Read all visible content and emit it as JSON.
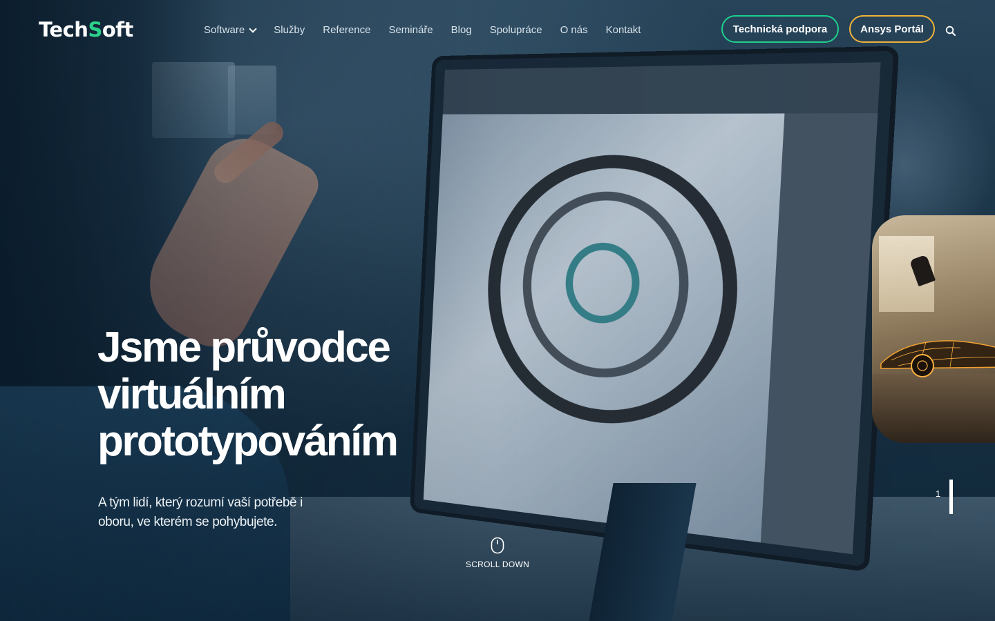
{
  "brand": {
    "logo_text_1": "Tech",
    "logo_text_s": "S",
    "logo_text_2": "oft",
    "accent_green": "#1ed08c",
    "accent_orange": "#f0b23a"
  },
  "nav": {
    "items": [
      {
        "label": "Software",
        "has_dropdown": true
      },
      {
        "label": "Služby"
      },
      {
        "label": "Reference"
      },
      {
        "label": "Semináře"
      },
      {
        "label": "Blog"
      },
      {
        "label": "Spolupráce"
      },
      {
        "label": "O nás"
      },
      {
        "label": "Kontakt"
      }
    ],
    "dropdown_icon": "chevron-down-icon"
  },
  "actions": {
    "support_label": "Technická podpora",
    "portal_label": "Ansys Portál",
    "search_icon": "search-icon"
  },
  "hero": {
    "headline": "Jsme průvodce virtuálním prototypováním",
    "subline": "A tým lidí, který rozumí vaší potřebě i oboru, ve kterém se pohybujete."
  },
  "slider": {
    "current": "1"
  },
  "scroll": {
    "label": "SCROLL DOWN",
    "icon": "mouse-icon"
  }
}
